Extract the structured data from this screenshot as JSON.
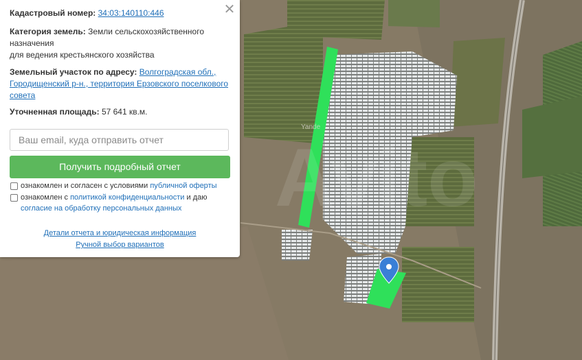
{
  "map": {
    "watermark_provider": "Yande",
    "watermark_site": "Avito",
    "parcel_color": "#2fe05a",
    "strip_color": "#2fe05a",
    "marker_color": "#3a7fd6",
    "marker_icon": "map-pin-icon"
  },
  "panel": {
    "close_icon": "close-icon",
    "cadastral_label": "Кадастровый номер:",
    "cadastral_value": "34:03:140110:446",
    "category_label": "Категория земель:",
    "category_value_line1": "Земли сельскохозяйственного",
    "category_value_line2": "назначения",
    "category_value_line3": "для ведения крестьянского хозяйства",
    "address_label": "Земельный участок по адресу:",
    "address_line1": "Волгоградская обл.,",
    "address_line2": "Городищенский р-н., территория Ерзовского поселкового",
    "address_line3": "совета",
    "area_label": "Уточненная площадь:",
    "area_value": "57 641 кв.м.",
    "email_placeholder": "Ваш email, куда отправить отчет",
    "cta_label": "Получить подробный отчет",
    "consent1_prefix": "ознакомлен и согласен с условиями",
    "consent1_link": "публичной оферты",
    "consent2_prefix": "ознакомлен с",
    "consent2_link": "политикой конфиденциальности",
    "consent2_mid": "и даю",
    "consent2_link2": "согласие на обработку персональных данных",
    "details_link": "Детали отчета и юридическая информация",
    "manual_link": "Ручной выбор вариантов",
    "accent_color": "#5cb85c",
    "link_color": "#1f6fb8"
  }
}
